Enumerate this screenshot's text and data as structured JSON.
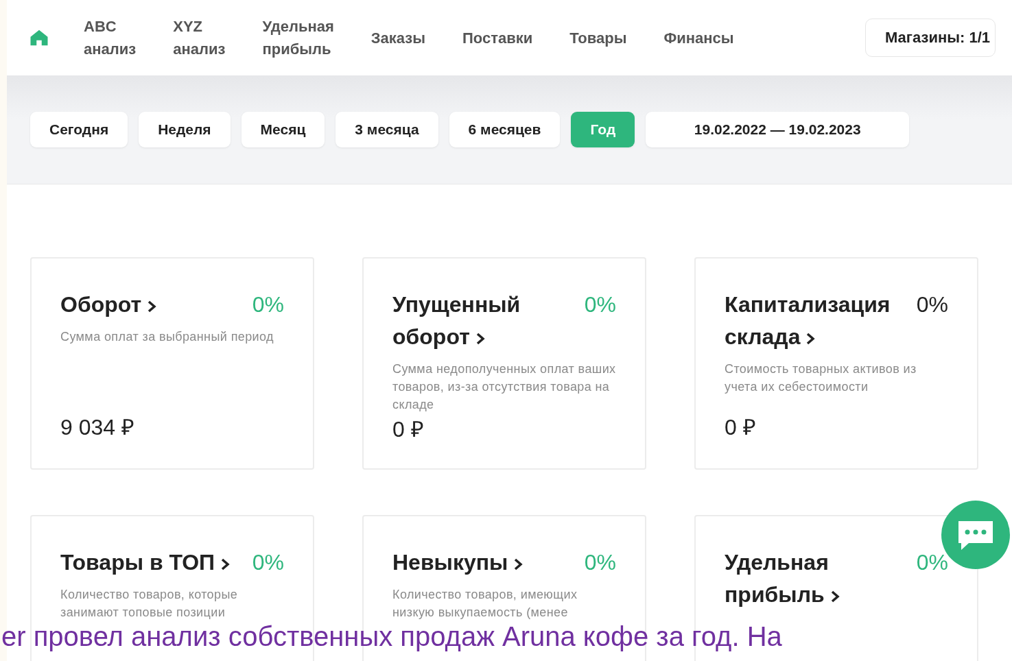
{
  "nav": {
    "items": [
      {
        "label": "ABC\nанализ"
      },
      {
        "label": "XYZ\nанализ"
      },
      {
        "label": "Удельная\nприбыль"
      },
      {
        "label": "Заказы"
      },
      {
        "label": "Поставки"
      },
      {
        "label": "Товары"
      },
      {
        "label": "Финансы"
      }
    ],
    "stores": "Магазины: 1/1"
  },
  "periods": [
    {
      "label": "Сегодня",
      "selected": false
    },
    {
      "label": "Неделя",
      "selected": false
    },
    {
      "label": "Месяц",
      "selected": false
    },
    {
      "label": "3 месяца",
      "selected": false
    },
    {
      "label": "6 месяцев",
      "selected": false
    },
    {
      "label": "Год",
      "selected": true
    }
  ],
  "date_range": "19.02.2022 — 19.02.2023",
  "cards": [
    {
      "title": "Оборот",
      "percent": "0%",
      "color": "#2eb67d",
      "description": "Сумма оплат за выбранный период",
      "value": "9 034 ₽"
    },
    {
      "title": "Упущенный оборот",
      "percent": "0%",
      "color": "#2eb67d",
      "description": "Сумма недополученных оплат ваших товаров, из-за отсутствия товара на складе",
      "value": "0 ₽"
    },
    {
      "title": "Капитализация склада",
      "percent": "0%",
      "color": "#222222",
      "description": "Стоимость товарных активов из учета их себестоимости",
      "value": "0 ₽"
    },
    {
      "title": "Товары в ТОП",
      "percent": "0%",
      "color": "#2eb67d",
      "description": "Количество товаров, которые занимают топовые позиции"
    },
    {
      "title": "Невыкупы",
      "percent": "0%",
      "color": "#2eb67d",
      "description": "Количество товаров, имеющих низкую выкупаемость (менее"
    },
    {
      "title": "Удельная прибыль",
      "percent": "0%",
      "color": "#2eb67d"
    }
  ],
  "caption": "er провел анализ собственных продаж Aruna кофе за год. На"
}
